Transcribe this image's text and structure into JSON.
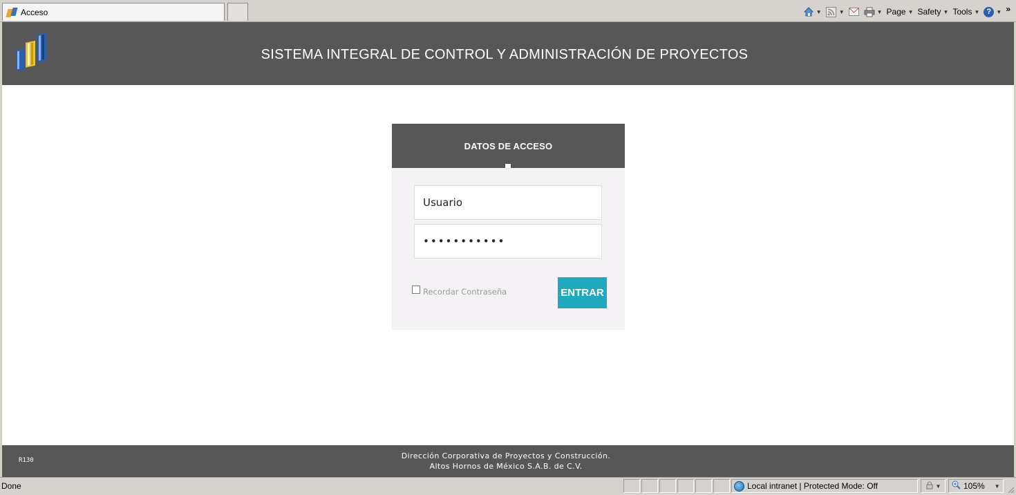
{
  "browser": {
    "tab_title": "Acceso",
    "commands": {
      "page": "Page",
      "safety": "Safety",
      "tools": "Tools",
      "help": "?",
      "overflow": "»"
    },
    "status": {
      "left": "Done",
      "zone": "Local intranet | Protected Mode: Off",
      "zoom": "105%"
    }
  },
  "header": {
    "title": "SISTEMA INTEGRAL DE CONTROL Y ADMINISTRACIÓN DE PROYECTOS"
  },
  "login": {
    "title": "DATOS DE ACCESO",
    "username_value": "Usuario",
    "password_value": "•••••••••••",
    "remember_label": "Recordar Contraseña",
    "remember_checked": false,
    "submit_label": "ENTRAR"
  },
  "footer": {
    "version": "R130",
    "line1": "Dirección Corporativa de Proyectos y Construcción.",
    "line2": "Altos Hornos de México S.A.B. de C.V."
  },
  "colors": {
    "header_bg": "#575757",
    "accent": "#1fa9bd",
    "card_bg": "#f4f2f4"
  }
}
